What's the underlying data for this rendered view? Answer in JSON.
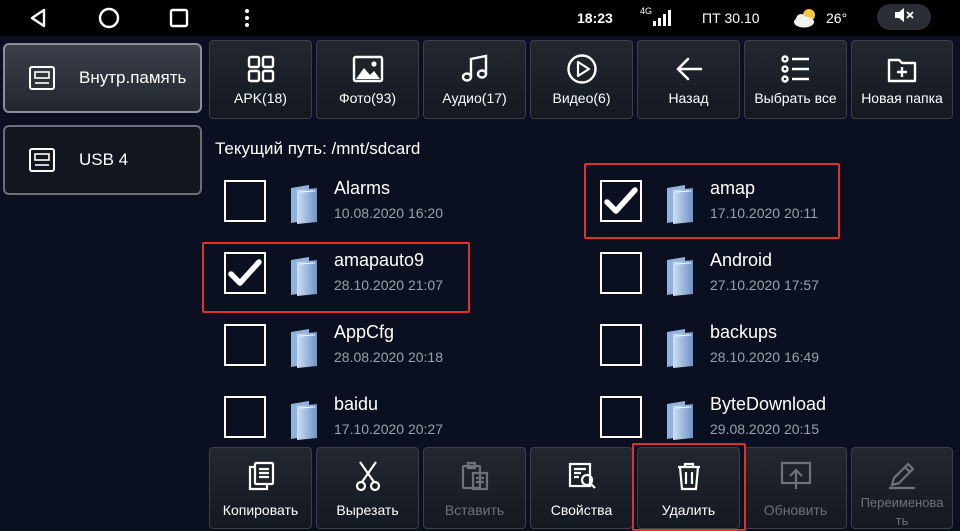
{
  "status_bar": {
    "time": "18:23",
    "network": "4G",
    "date": "ПТ 30.10",
    "temperature": "26°",
    "weather_icon": "partly-cloudy-icon",
    "mute_icon": "speaker-muted-icon"
  },
  "sidebar": {
    "items": [
      {
        "label": "Внутр.память",
        "icon": "storage-icon",
        "active": true
      },
      {
        "label": "USB 4",
        "icon": "storage-icon",
        "active": false
      }
    ]
  },
  "toolbar": {
    "buttons": [
      {
        "label": "APK(18)",
        "icon": "grid-icon"
      },
      {
        "label": "Фото(93)",
        "icon": "image-icon"
      },
      {
        "label": "Аудио(17)",
        "icon": "music-note-icon"
      },
      {
        "label": "Видео(6)",
        "icon": "play-icon"
      },
      {
        "label": "Назад",
        "icon": "arrow-left-icon"
      },
      {
        "label": "Выбрать все",
        "icon": "list-icon"
      },
      {
        "label": "Новая папка",
        "icon": "new-folder-icon"
      }
    ]
  },
  "path": {
    "text": "Текущий путь: /mnt/sdcard"
  },
  "files": [
    {
      "name": "Alarms",
      "date": "10.08.2020 16:20",
      "checked": false
    },
    {
      "name": "amap",
      "date": "17.10.2020 20:11",
      "checked": true
    },
    {
      "name": "amapauto9",
      "date": "28.10.2020 21:07",
      "checked": true
    },
    {
      "name": "Android",
      "date": "27.10.2020 17:57",
      "checked": false
    },
    {
      "name": "AppCfg",
      "date": "28.08.2020 20:18",
      "checked": false
    },
    {
      "name": "backups",
      "date": "28.10.2020 16:49",
      "checked": false
    },
    {
      "name": "baidu",
      "date": "17.10.2020 20:27",
      "checked": false
    },
    {
      "name": "ByteDownload",
      "date": "29.08.2020 20:15",
      "checked": false
    }
  ],
  "actions": {
    "buttons": [
      {
        "label": "Копировать",
        "icon": "copy-icon",
        "enabled": true
      },
      {
        "label": "Вырезать",
        "icon": "scissors-icon",
        "enabled": true
      },
      {
        "label": "Вставить",
        "icon": "paste-icon",
        "enabled": false
      },
      {
        "label": "Свойства",
        "icon": "properties-icon",
        "enabled": true
      },
      {
        "label": "Удалить",
        "icon": "trash-icon",
        "enabled": true
      },
      {
        "label": "Обновить",
        "icon": "upload-icon",
        "enabled": false
      },
      {
        "label": "Переименова\nть",
        "icon": "pencil-icon",
        "enabled": false
      }
    ]
  },
  "colors": {
    "background": "#0b1020",
    "highlight": "#e0302a",
    "disabled": "#6d727b"
  }
}
